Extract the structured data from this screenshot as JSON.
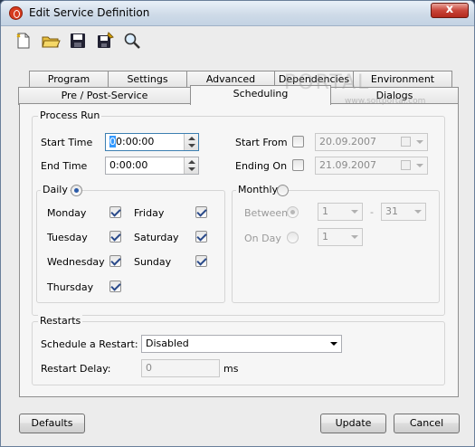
{
  "window": {
    "title": "Edit Service Definition",
    "close_glyph": "x"
  },
  "toolbar": {
    "items": [
      {
        "icon": "new-document-icon"
      },
      {
        "icon": "open-folder-icon"
      },
      {
        "icon": "save-disk-icon"
      },
      {
        "icon": "save-as-disk-icon"
      },
      {
        "icon": "search-icon"
      }
    ]
  },
  "tabs": {
    "row_back": [
      "Program",
      "Settings",
      "Advanced",
      "Dependencies",
      "Environment"
    ],
    "row_front": [
      "Pre / Post-Service",
      "Scheduling",
      "Dialogs"
    ],
    "active": "Scheduling"
  },
  "process_run": {
    "title": "Process Run",
    "start_time_label": "Start Time",
    "start_time_value_sel": "0",
    "start_time_value_rest": "0:00:00",
    "end_time_label": "End Time",
    "end_time_value": "0:00:00",
    "start_from_label": "Start From",
    "start_from_date": "20.09.2007",
    "ending_on_label": "Ending On",
    "ending_on_date": "21.09.2007"
  },
  "daily": {
    "label": "Daily",
    "days_left": [
      "Monday",
      "Tuesday",
      "Wednesday",
      "Thursday"
    ],
    "days_right": [
      "Friday",
      "Saturday",
      "Sunday"
    ]
  },
  "monthly": {
    "label": "Monthly",
    "between_label": "Between",
    "between_from": "1",
    "between_sep": "-",
    "between_to": "31",
    "on_day_label": "On Day",
    "on_day_value": "1"
  },
  "restarts": {
    "title": "Restarts",
    "schedule_label": "Schedule a Restart:",
    "schedule_value": "Disabled",
    "delay_label": "Restart Delay:",
    "delay_value": "0",
    "delay_unit": "ms"
  },
  "buttons": {
    "defaults": "Defaults",
    "update": "Update",
    "cancel": "Cancel"
  },
  "watermark": {
    "text": "PORTAL",
    "sub": "www.softportal.com"
  }
}
